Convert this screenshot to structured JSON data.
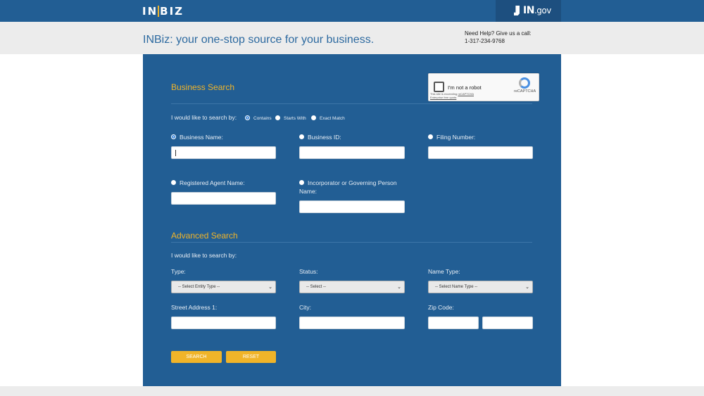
{
  "header": {
    "logo_left": "IN",
    "logo_right": "BIZ",
    "ingov_bold": "IN",
    "ingov_rest": ".gov"
  },
  "subheader": {
    "tagline": "INBiz: your one-stop source for your business.",
    "help_line1": "Need Help? Give us a call:",
    "help_phone": "1-317-234-9768"
  },
  "captcha": {
    "label": "I'm not a robot",
    "brand": "reCAPTCHA",
    "fine_print_1": "This site is exceeding",
    "fine_print_link1": "reCAPTCHA",
    "fine_print_link2": "Enterprise free quota"
  },
  "business_search": {
    "title": "Business Search",
    "search_by_label": "I would like to search by:",
    "modes": [
      "Contains",
      "Starts With",
      "Exact Match"
    ],
    "fields": {
      "business_name": "Business Name:",
      "business_id": "Business ID:",
      "filing_number": "Filing Number:",
      "registered_agent": "Registered Agent Name:",
      "incorporator_line1": "Incorporator or Governing Person",
      "incorporator_line2": "Name:"
    }
  },
  "advanced_search": {
    "title": "Advanced Search",
    "search_by_label": "I would like to search by:",
    "type_label": "Type:",
    "type_value": "-- Select Entity Type --",
    "status_label": "Status:",
    "status_value": "-- Select --",
    "name_type_label": "Name Type:",
    "name_type_value": "-- Select Name Type --",
    "street_label": "Street Address 1:",
    "city_label": "City:",
    "zip_label": "Zip Code:"
  },
  "buttons": {
    "search": "SEARCH",
    "reset": "RESET"
  },
  "colors": {
    "brand_blue": "#225e94",
    "accent_gold": "#f0b429",
    "tagline_blue": "#2d6aa0"
  }
}
